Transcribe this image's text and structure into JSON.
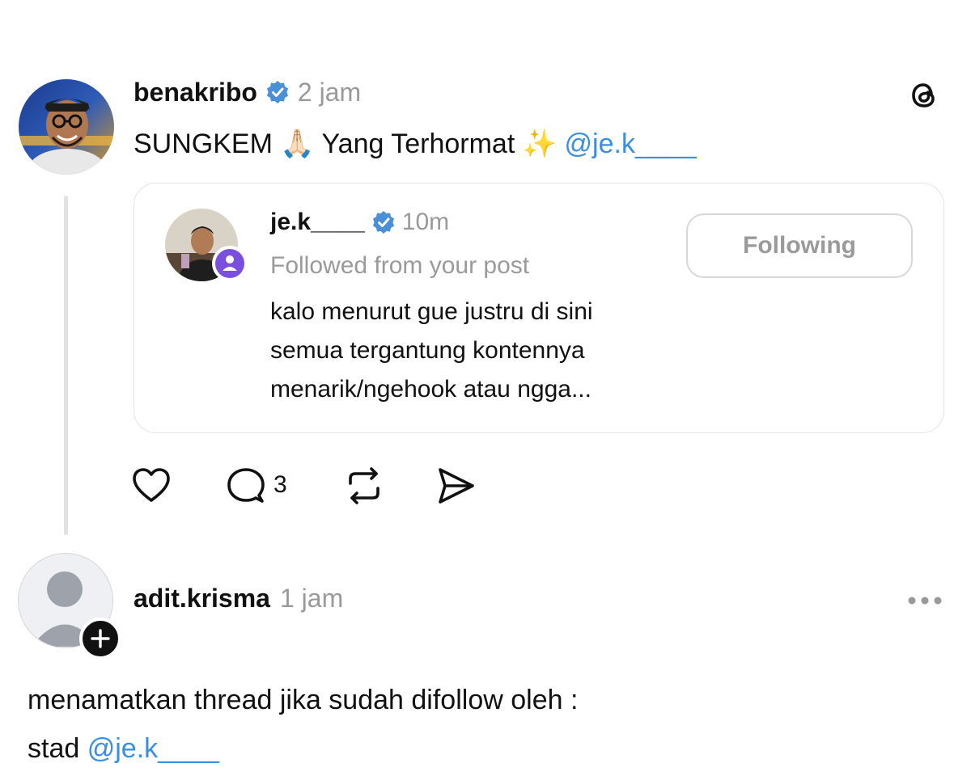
{
  "post": {
    "username": "benakribo",
    "time": "2 jam",
    "text_before": "SUNGKEM 🙏🏻 Yang Terhormat ✨ ",
    "mention": "@je.k____",
    "reply_count": "3"
  },
  "embedded": {
    "username": "je.k____",
    "time": "10m",
    "subtitle": "Followed from your post",
    "text_line1": "kalo menurut gue justru di sini",
    "text_line2": "semua tergantung kontennya",
    "text_line3": "menarik/ngehook atau ngga...",
    "follow_button": "Following"
  },
  "reply": {
    "username": "adit.krisma",
    "time": "1 jam",
    "text_line1": "menamatkan thread jika sudah difollow oleh :",
    "text_line2_before": "stad ",
    "mention": "@je.k____"
  },
  "colors": {
    "mention": "#3a8fde",
    "verified": "#4a90d9",
    "purple_badge": "#7a4fe0"
  },
  "icons": {
    "app": "threads-logo-icon",
    "like": "heart-icon",
    "comment": "comment-icon",
    "repost": "repost-icon",
    "share": "send-icon",
    "more": "more-options-icon"
  }
}
